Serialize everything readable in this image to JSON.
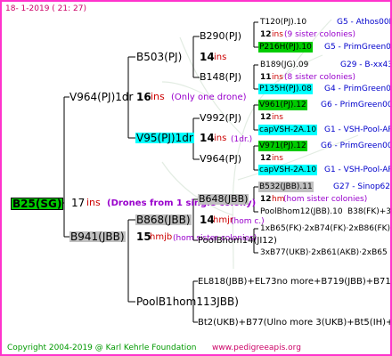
{
  "header": {
    "date": "18-  1-2019 (  21:  27)"
  },
  "footer": {
    "copyright": "Copyright 2004-2019 @ Karl Kehrle Foundation",
    "website": "www.pedigreeapis.org"
  },
  "colors": {
    "frame": "#ff33cc",
    "root_bg": "#00cc00",
    "green_bg": "#00cc00",
    "cyan_bg": "#00ffff",
    "gray_bg": "#c0c0c0",
    "line": "#000000"
  },
  "root": {
    "label": "B25(SG)",
    "ins_num": "17",
    "ins_word": "ins",
    "note": "(Drones from 1 single colony)"
  },
  "gen1_top": {
    "label": "V964(PJ)1dr",
    "ins_num": "16",
    "ins_word": "ins",
    "note": "(Only one drone)"
  },
  "gen1_bot": {
    "label": "B941(JBB)",
    "ins_num": "15",
    "ins_word": "hmjb",
    "note": "(hom sister colonies)"
  },
  "gen2": {
    "b503": {
      "label": "B503(PJ)",
      "ins_num": "14",
      "ins_word": "ins"
    },
    "v95": {
      "label": "V95(PJ)1dr",
      "ins_num": "14",
      "ins_word": "ins",
      "note": "(1dr.)"
    },
    "b868": {
      "label": "B868(JBB)",
      "ins_num": "14",
      "ins_word": "hmjr",
      "note": "(hom c.)"
    },
    "poolb1hom": {
      "label": "PoolB1hom113JBB)"
    }
  },
  "gen3": {
    "b290": {
      "label": "B290(PJ)",
      "ins_num": "13",
      "ins_word": "ins"
    },
    "b148": {
      "label": "B148(PJ)"
    },
    "v992": {
      "label": "V992(PJ)",
      "ins_num": "13",
      "ins_word": "ins"
    },
    "v964": {
      "label": "V964(PJ)"
    },
    "b648": {
      "label": "B648(JBB)",
      "ins_num": "13",
      "ins_word": "hmjr",
      "note": "(hom c.)"
    },
    "poolbhom14": {
      "label": "PoolBhom14(JI12)"
    },
    "el818": {
      "label": "EL818(JBB)+EL73no more+B719(JBB)+B717(JBB)"
    },
    "bt2": {
      "label": "Bt2(UKB)+B77(Ulno more 3(UKB)+Bt5(IH)+Bt3(IH)"
    }
  },
  "gen4": {
    "t120": {
      "label": "T120(PJ).10",
      "note_num": "12",
      "note_word": "ins",
      "note": "(9 sister colonies)",
      "source": "G5 - Athos00R"
    },
    "p216h": {
      "label": "P216H(PJ).10",
      "source": "G5 - PrimGreen00"
    },
    "b189": {
      "label": "B189(JG).09",
      "source": "G29 - B-xx43"
    },
    "p135h": {
      "label": "P135H(PJ).08",
      "note_num": "11",
      "note_word": "ins",
      "note": "(8 sister colonies)",
      "source": "G4 - PrimGreen00"
    },
    "v961": {
      "label": "V961(PJ).12",
      "note_num": "12",
      "note_word": "ins",
      "source": "G6 - PrimGreen00"
    },
    "capvsh1": {
      "label": "capVSH-2A.10",
      "source": "G1 - VSH-Pool-AR"
    },
    "v971": {
      "label": "V971(PJ).12",
      "note_num": "12",
      "note_word": "ins",
      "source": "G6 - PrimGreen00"
    },
    "capvsh2": {
      "label": "capVSH-2A.10",
      "source": "G1 - VSH-Pool-AR"
    },
    "b532": {
      "label": "B532(JBB).11",
      "note_num": "12",
      "note_word": "hm",
      "note": "(hom sister colonies)",
      "source": "G27 - Sinop62R"
    },
    "poolbhom12": {
      "label": "PoolBhom12(JBB).10",
      "extra": "B38(FK)+3"
    },
    "x865": {
      "label": "1xB65(FK)·2xB74(FK)·2xB86(FK)"
    },
    "x877": {
      "label": "3xB77(UKB)·2xB61(AKB)·2xB65"
    }
  }
}
